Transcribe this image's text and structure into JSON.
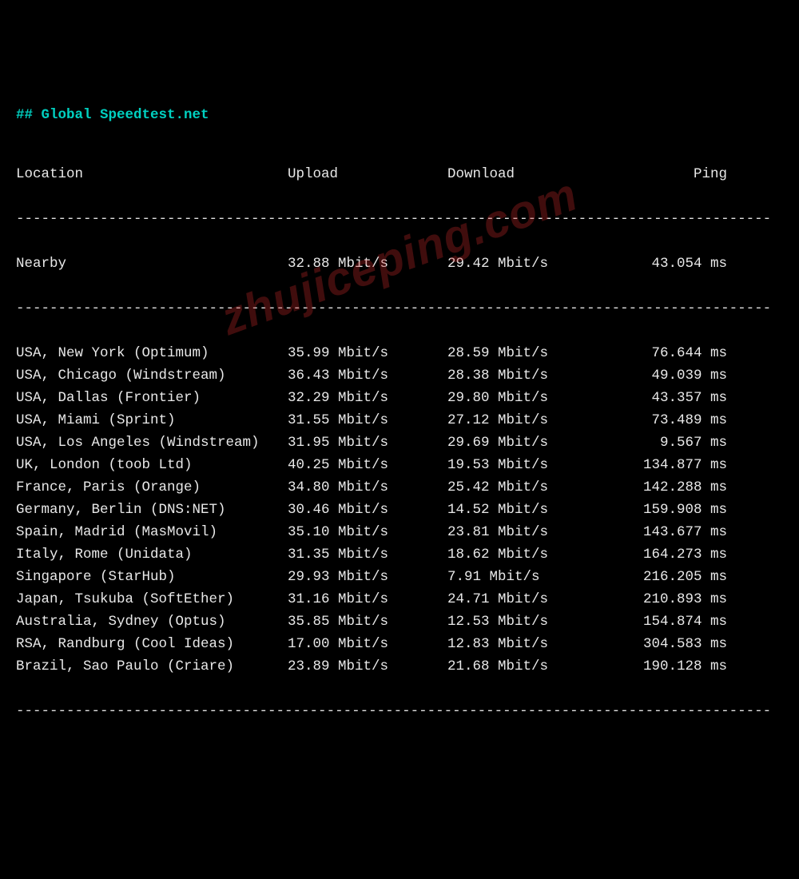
{
  "title": "## Global Speedtest.net",
  "columns": {
    "location": "Location",
    "upload": "Upload",
    "download": "Download",
    "ping": "Ping"
  },
  "nearby": {
    "label": "Nearby",
    "upload": "32.88 Mbit/s",
    "download": "29.42 Mbit/s",
    "ping": "43.054 ms"
  },
  "rows": [
    {
      "location": "USA, New York (Optimum)",
      "upload": "35.99 Mbit/s",
      "download": "28.59 Mbit/s",
      "ping": "76.644 ms"
    },
    {
      "location": "USA, Chicago (Windstream)",
      "upload": "36.43 Mbit/s",
      "download": "28.38 Mbit/s",
      "ping": "49.039 ms"
    },
    {
      "location": "USA, Dallas (Frontier)",
      "upload": "32.29 Mbit/s",
      "download": "29.80 Mbit/s",
      "ping": "43.357 ms"
    },
    {
      "location": "USA, Miami (Sprint)",
      "upload": "31.55 Mbit/s",
      "download": "27.12 Mbit/s",
      "ping": "73.489 ms"
    },
    {
      "location": "USA, Los Angeles (Windstream)",
      "upload": "31.95 Mbit/s",
      "download": "29.69 Mbit/s",
      "ping": "9.567 ms"
    },
    {
      "location": "UK, London (toob Ltd)",
      "upload": "40.25 Mbit/s",
      "download": "19.53 Mbit/s",
      "ping": "134.877 ms"
    },
    {
      "location": "France, Paris (Orange)",
      "upload": "34.80 Mbit/s",
      "download": "25.42 Mbit/s",
      "ping": "142.288 ms"
    },
    {
      "location": "Germany, Berlin (DNS:NET)",
      "upload": "30.46 Mbit/s",
      "download": "14.52 Mbit/s",
      "ping": "159.908 ms"
    },
    {
      "location": "Spain, Madrid (MasMovil)",
      "upload": "35.10 Mbit/s",
      "download": "23.81 Mbit/s",
      "ping": "143.677 ms"
    },
    {
      "location": "Italy, Rome (Unidata)",
      "upload": "31.35 Mbit/s",
      "download": "18.62 Mbit/s",
      "ping": "164.273 ms"
    },
    {
      "location": "Singapore (StarHub)",
      "upload": "29.93 Mbit/s",
      "download": "7.91 Mbit/s",
      "ping": "216.205 ms"
    },
    {
      "location": "Japan, Tsukuba (SoftEther)",
      "upload": "31.16 Mbit/s",
      "download": "24.71 Mbit/s",
      "ping": "210.893 ms"
    },
    {
      "location": "Australia, Sydney (Optus)",
      "upload": "35.85 Mbit/s",
      "download": "12.53 Mbit/s",
      "ping": "154.874 ms"
    },
    {
      "location": "RSA, Randburg (Cool Ideas)",
      "upload": "17.00 Mbit/s",
      "download": "12.83 Mbit/s",
      "ping": "304.583 ms"
    },
    {
      "location": "Brazil, Sao Paulo (Criare)",
      "upload": "23.89 Mbit/s",
      "download": "21.68 Mbit/s",
      "ping": "190.128 ms"
    }
  ],
  "watermark": "zhujiceping.com"
}
